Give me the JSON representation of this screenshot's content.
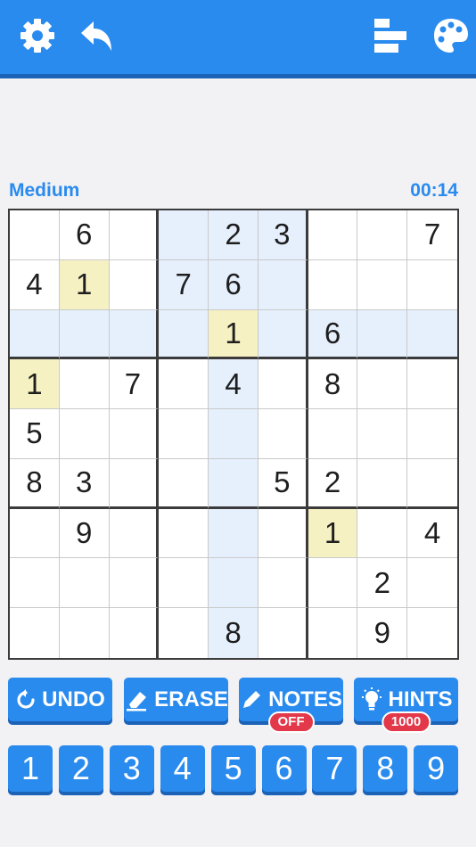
{
  "header": {
    "icons": [
      "gear-icon",
      "back-arrow-icon",
      "stats-icon",
      "palette-icon"
    ]
  },
  "status": {
    "difficulty": "Medium",
    "timer": "00:14"
  },
  "grid": [
    [
      "",
      "6",
      "",
      "",
      "2",
      "3",
      "",
      "",
      "7"
    ],
    [
      "4",
      "1",
      "",
      "7",
      "6",
      "",
      "",
      "",
      ""
    ],
    [
      "",
      "",
      "",
      "",
      "1",
      "",
      "6",
      "",
      ""
    ],
    [
      "1",
      "",
      "7",
      "",
      "4",
      "",
      "8",
      "",
      ""
    ],
    [
      "5",
      "",
      "",
      "",
      "",
      "",
      "",
      "",
      ""
    ],
    [
      "8",
      "3",
      "",
      "",
      "",
      "5",
      "2",
      "",
      ""
    ],
    [
      "",
      "9",
      "",
      "",
      "",
      "",
      "1",
      "",
      "4"
    ],
    [
      "",
      "",
      "",
      "",
      "",
      "",
      "",
      "2",
      ""
    ],
    [
      "",
      "",
      "",
      "",
      "8",
      "",
      "",
      "9",
      ""
    ]
  ],
  "highlight": {
    "row": 2,
    "col": 4,
    "value": "1"
  },
  "colors": {
    "accent": "#2a8bef",
    "accent_dark": "#1c62b7",
    "badge": "#e2384a",
    "same_number": "#f6f1c3",
    "highlight": "#e6f0fd"
  },
  "actions": {
    "undo": "UNDO",
    "erase": "ERASE",
    "notes": "NOTES",
    "notes_state": "OFF",
    "hints": "HINTS",
    "hints_count": "1000"
  },
  "numpad": [
    "1",
    "2",
    "3",
    "4",
    "5",
    "6",
    "7",
    "8",
    "9"
  ]
}
